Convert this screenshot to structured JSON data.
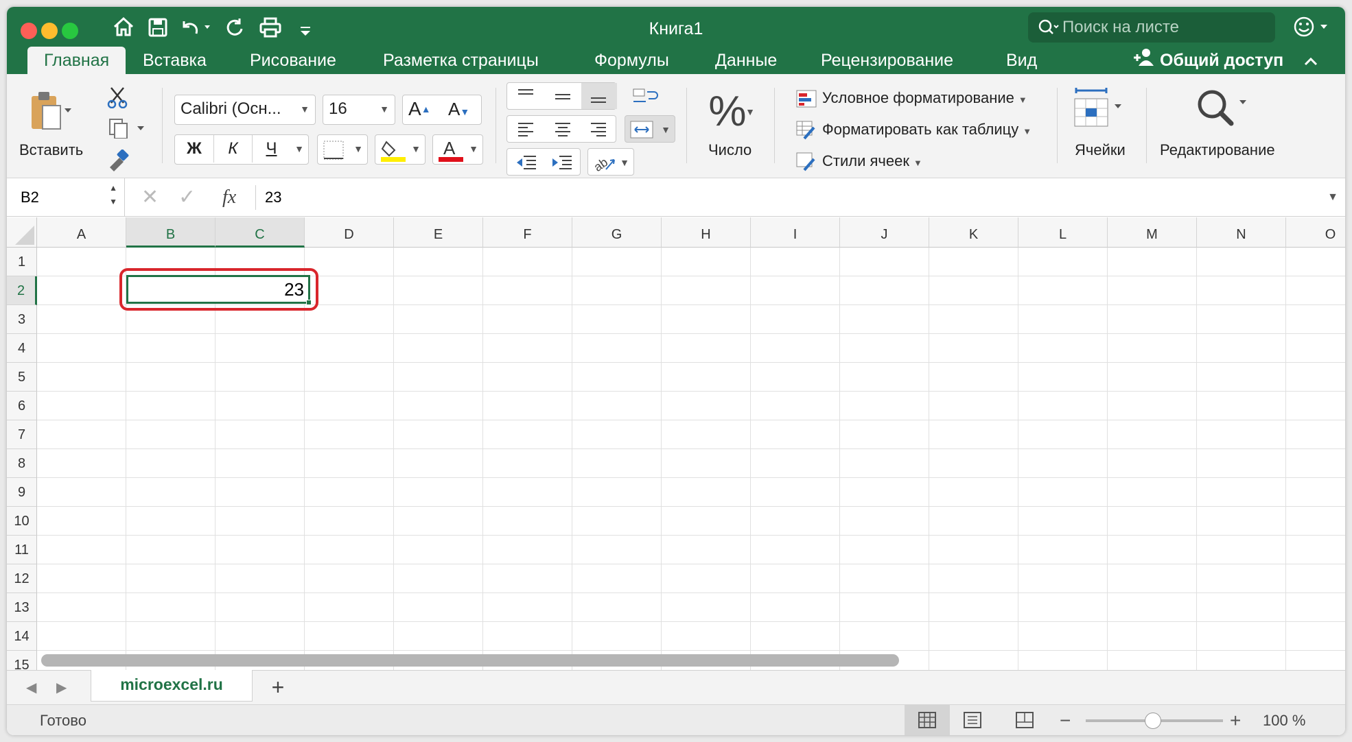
{
  "window": {
    "title": "Книга1"
  },
  "search": {
    "placeholder": "Поиск на листе"
  },
  "ribbon_tabs": [
    "Главная",
    "Вставка",
    "Рисование",
    "Разметка страницы",
    "Формулы",
    "Данные",
    "Рецензирование",
    "Вид"
  ],
  "share_label": "Общий доступ",
  "clipboard": {
    "paste_label": "Вставить"
  },
  "font": {
    "name": "Calibri (Осн...",
    "size": "16",
    "bold": "Ж",
    "italic": "К",
    "underline": "Ч"
  },
  "number": {
    "symbol": "%",
    "label": "Число"
  },
  "styles": {
    "conditional": "Условное форматирование",
    "format_table": "Форматировать как таблицу",
    "cell_styles": "Стили ячеек"
  },
  "cells_label": "Ячейки",
  "editing_label": "Редактирование",
  "formula_bar": {
    "name_box": "B2",
    "fx": "fx",
    "value": "23"
  },
  "columns": [
    "A",
    "B",
    "C",
    "D",
    "E",
    "F",
    "G",
    "H",
    "I",
    "J",
    "K",
    "L",
    "M",
    "N",
    "O"
  ],
  "rows": [
    "1",
    "2",
    "3",
    "4",
    "5",
    "6",
    "7",
    "8",
    "9",
    "10",
    "11",
    "12",
    "13",
    "14",
    "15"
  ],
  "cell_value": "23",
  "sheet": {
    "name": "microexcel.ru",
    "add": "+"
  },
  "status": {
    "text": "Готово",
    "zoom": "100 %",
    "minus": "−",
    "plus": "+"
  },
  "colors": {
    "brand": "#217346",
    "highlight_frame": "#d9262c"
  }
}
